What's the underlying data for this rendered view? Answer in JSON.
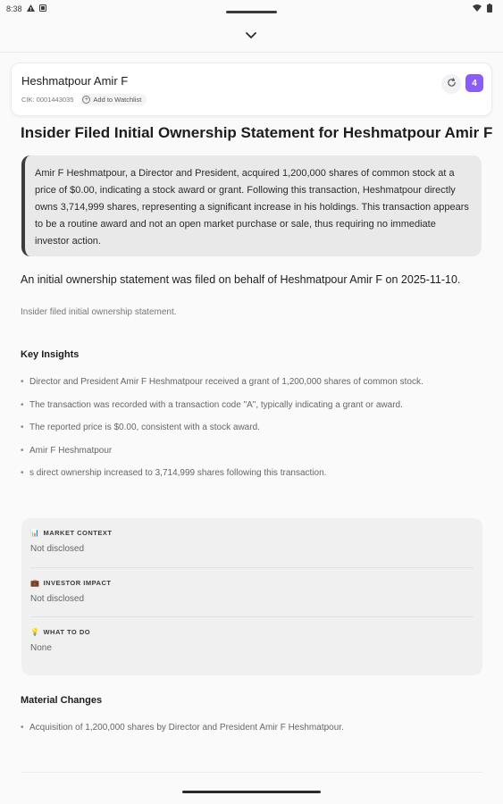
{
  "status_bar": {
    "time": "8:38",
    "left_icons": [
      "warning-icon",
      "notification-icon"
    ],
    "right_icons": [
      "wifi-icon",
      "battery-icon"
    ]
  },
  "header": {
    "company": "Heshmatpour Amir F",
    "cik": "CIK: 0001443035",
    "watchlist_label": "Add to Watchlist",
    "badge_count": "4",
    "badge_color": "#8b5cf6"
  },
  "headline": "Insider Filed Initial Ownership Statement for Heshmatpour Amir F",
  "summary": "Amir F Heshmatpour, a Director and President, acquired 1,200,000 shares of common stock at a price of $0.00, indicating a stock award or grant. Following this transaction, Heshmatpour directly owns 3,714,999 shares, representing a significant increase in his holdings. This transaction appears to be a routine award and not an open market purchase or sale, thus requiring no immediate investor action.",
  "lead": "An initial ownership statement was filed on behalf of Heshmatpour Amir F on 2025-11-10.",
  "sub_note": "Insider filed initial ownership statement.",
  "key_insights": {
    "title": "Key Insights",
    "items": [
      "Director and President Amir F Heshmatpour received a grant of 1,200,000 shares of common stock.",
      "The transaction was recorded with a transaction code \"A\", typically indicating a grant or award.",
      "The reported price is $0.00, consistent with a stock award.",
      "Amir F Heshmatpour",
      "s direct ownership increased to 3,714,999 shares following this transaction."
    ]
  },
  "context": {
    "market": {
      "emoji": "📊",
      "label": "MARKET CONTEXT",
      "value": "Not disclosed"
    },
    "impact": {
      "emoji": "💼",
      "label": "INVESTOR IMPACT",
      "value": "Not disclosed"
    },
    "todo": {
      "emoji": "💡",
      "label": "WHAT TO DO",
      "value": "None"
    }
  },
  "material_changes": {
    "title": "Material Changes",
    "items": [
      "Acquisition of 1,200,000 shares by Director and President Amir F Heshmatpour."
    ]
  }
}
